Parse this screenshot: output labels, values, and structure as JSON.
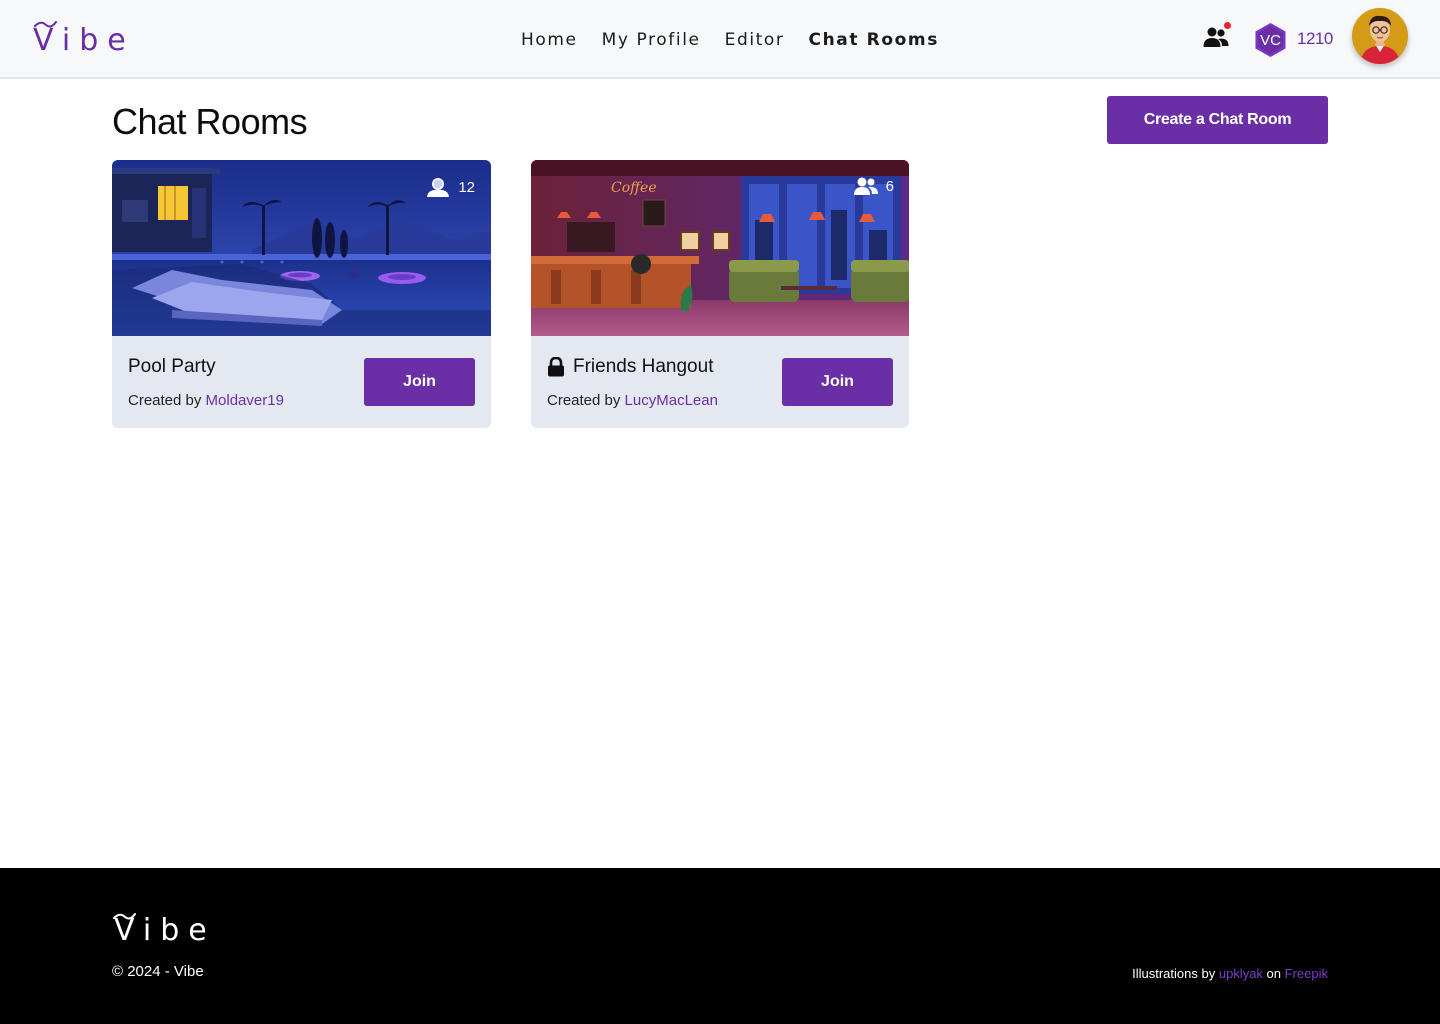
{
  "brand": {
    "name": "Vibe",
    "color": "#6b2fa5"
  },
  "nav": {
    "items": [
      {
        "label": "Home",
        "active": false
      },
      {
        "label": "My Profile",
        "active": false
      },
      {
        "label": "Editor",
        "active": false
      },
      {
        "label": "Chat Rooms",
        "active": true
      }
    ]
  },
  "header": {
    "friends_icon": "users-icon",
    "has_notification": true,
    "vc_badge": "VC",
    "vc_count": "1210"
  },
  "main": {
    "title": "Chat Rooms",
    "create_button": "Create a Chat Room",
    "rooms": [
      {
        "name": "Pool Party",
        "members": "12",
        "locked": false,
        "created_by_prefix": "Created by",
        "creator": "Moldaver19",
        "join_label": "Join",
        "image": "pool-party-night-illustration"
      },
      {
        "name": "Friends Hangout",
        "members": "6",
        "locked": true,
        "created_by_prefix": "Created by",
        "creator": "LucyMacLean",
        "join_label": "Join",
        "image": "coffee-shop-interior-illustration"
      }
    ]
  },
  "footer": {
    "brand": "Vibe",
    "copyright": "© 2024 - Vibe",
    "credits_prefix": "Illustrations by",
    "credits_author": "upklyak",
    "credits_on": "on",
    "credits_site": "Freepik"
  }
}
